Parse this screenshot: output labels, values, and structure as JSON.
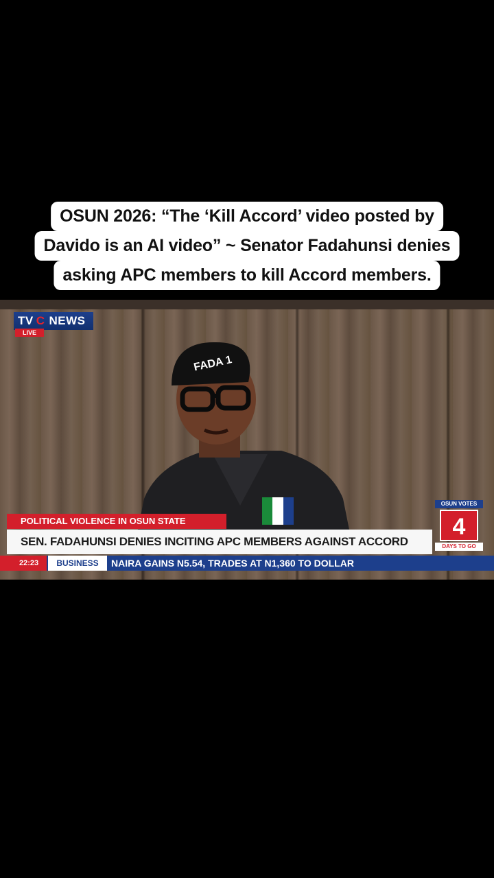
{
  "caption": {
    "line1": "OSUN 2026: “The ‘Kill Accord’ video posted by",
    "line2": "Davido is an AI video” ~ Senator Fadahunsi denies",
    "line3": "asking APC members to kill Accord members."
  },
  "broadcast": {
    "logo_tv": "TV",
    "logo_c": "C",
    "logo_news": "NEWS",
    "live_badge": "LIVE",
    "cap_text": "FADA 1",
    "strap_top": "POLITICAL VIOLENCE IN OSUN STATE",
    "headline": "SEN. FADAHUNSI DENIES INCITING APC MEMBERS AGAINST ACCORD PARTY",
    "clock": "22:23",
    "segment": "BUSINESS",
    "ticker": "NAIRA GAINS N5.54, TRADES AT N1,360 TO DOLLAR",
    "countdown_top": "OSUN VOTES",
    "countdown_number": "4",
    "countdown_bottom": "DAYS TO GO"
  },
  "colors": {
    "brand_blue": "#1d3f8c",
    "brand_red": "#d31f2b",
    "caption_bg": "#ffffff"
  }
}
